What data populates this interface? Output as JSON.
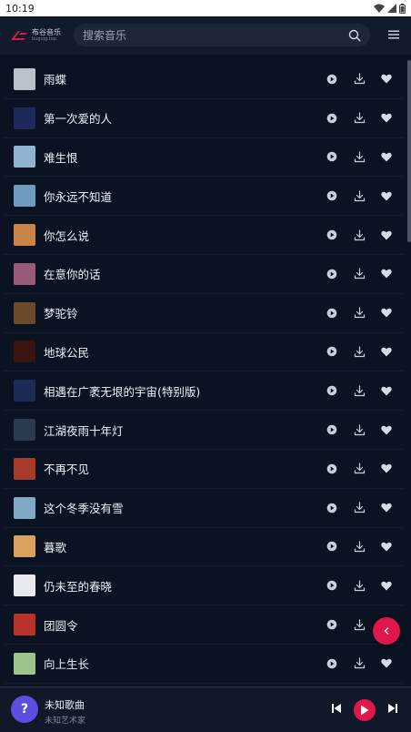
{
  "status": {
    "time": "10:19"
  },
  "header": {
    "logo_name": "布谷音乐",
    "logo_domain": "bugujg.top",
    "search_placeholder": "搜索音乐"
  },
  "songs": [
    {
      "title": "雨蝶",
      "cover": "#b9c2c9"
    },
    {
      "title": "第一次爱的人",
      "cover": "#1b2a5a"
    },
    {
      "title": "难生恨",
      "cover": "#8fb4cf"
    },
    {
      "title": "你永远不知道",
      "cover": "#6f9bc0"
    },
    {
      "title": "你怎么说",
      "cover": "#c98448"
    },
    {
      "title": "在意你的话",
      "cover": "#9a5a7a"
    },
    {
      "title": "梦驼铃",
      "cover": "#6b4a2a"
    },
    {
      "title": "地球公民",
      "cover": "#3a1510"
    },
    {
      "title": "相遇在广袤无垠的宇宙(特别版)",
      "cover": "#1c2b55"
    },
    {
      "title": "江湖夜雨十年灯",
      "cover": "#2c3a4f"
    },
    {
      "title": "不再不见",
      "cover": "#a83a2a"
    },
    {
      "title": "这个冬季没有雪",
      "cover": "#7fa9c4"
    },
    {
      "title": "暮歌",
      "cover": "#d9a15c"
    },
    {
      "title": "仍未至的春晓",
      "cover": "#e8eaee"
    },
    {
      "title": "团圆令",
      "cover": "#b8322a"
    },
    {
      "title": "向上生长",
      "cover": "#9cc38a"
    }
  ],
  "player": {
    "avatar_label": "?",
    "title": "未知歌曲",
    "artist": "未知艺术家"
  },
  "colors": {
    "accent": "#e0184a",
    "background": "#0b1222",
    "header": "#121a2d"
  },
  "icons": [
    "play-circle-icon",
    "download-icon",
    "heart-icon",
    "search-icon",
    "menu-icon",
    "chevron-left-icon",
    "skip-previous-icon",
    "play-icon",
    "skip-next-icon"
  ]
}
